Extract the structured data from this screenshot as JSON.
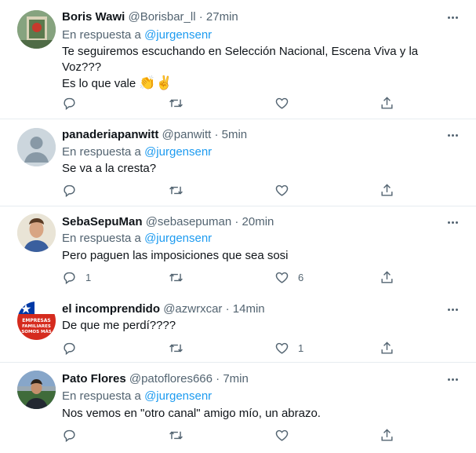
{
  "reply_prefix": "En respuesta a ",
  "tweets": [
    {
      "name": "Boris Wawi",
      "handle": "@Borisbar_ll",
      "sep": " · ",
      "time": "27min",
      "reply_to": "@jurgensenr",
      "lines": [
        "Te seguiremos escuchando en Selección Nacional, Escena Viva y la",
        "Voz???"
      ],
      "line3_text": "Es lo que vale ",
      "line3_emoji": "👏✌️",
      "reply_count": "",
      "like_count": ""
    },
    {
      "name": "panaderiapanwitt",
      "handle": "@panwitt",
      "sep": " · ",
      "time": "5min",
      "reply_to": "@jurgensenr",
      "text": "Se va a la cresta?",
      "reply_count": "",
      "like_count": ""
    },
    {
      "name": "SebaSepuMan",
      "handle": "@sebasepuman",
      "sep": " · ",
      "time": "20min",
      "reply_to": "@jurgensenr",
      "text": "Pero paguen las imposiciones que sea sosi",
      "reply_count": "1",
      "like_count": "6"
    },
    {
      "name": "el incomprendido",
      "handle": "@azwrxcar",
      "sep": " · ",
      "time": "14min",
      "text": "De que me perdí????",
      "reply_count": "",
      "like_count": "1",
      "avatar_text": [
        "EMPRESAS",
        "FAMILIARES",
        "SOMOS MÁS"
      ]
    },
    {
      "name": "Pato Flores",
      "handle": "@patoflores666",
      "sep": " · ",
      "time": "7min",
      "reply_to": "@jurgensenr",
      "text": "Nos vemos en \"otro canal\" amigo mío, un abrazo.",
      "reply_count": "",
      "like_count": ""
    }
  ],
  "colors": {
    "accent": "#1d9bf0",
    "secondary_text": "#536471",
    "divider": "#e6ecf0"
  }
}
